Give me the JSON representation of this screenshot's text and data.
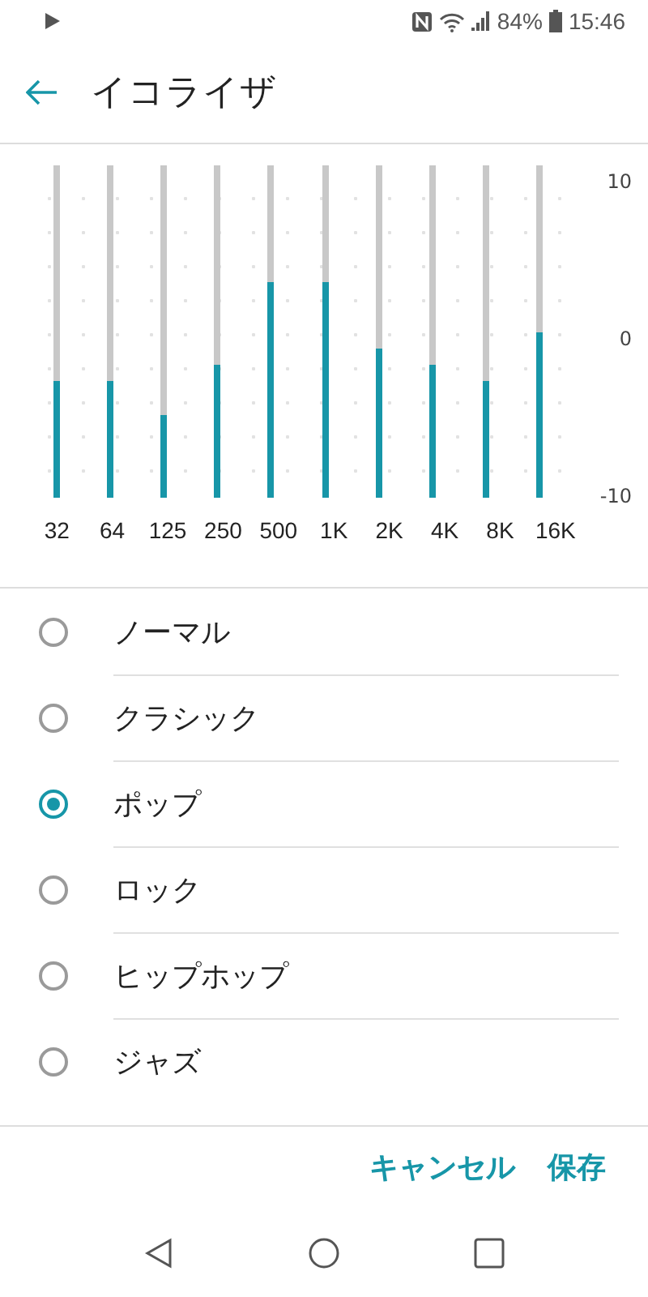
{
  "status_bar": {
    "battery": "84%",
    "time": "15:46"
  },
  "header": {
    "title": "イコライザ"
  },
  "equalizer": {
    "scale": [
      "10",
      "0",
      "-10"
    ],
    "bands": [
      {
        "label": "32",
        "level": 0.35
      },
      {
        "label": "64",
        "level": 0.35
      },
      {
        "label": "125",
        "level": 0.25
      },
      {
        "label": "250",
        "level": 0.4
      },
      {
        "label": "500",
        "level": 0.65
      },
      {
        "label": "1K",
        "level": 0.65
      },
      {
        "label": "2K",
        "level": 0.45
      },
      {
        "label": "4K",
        "level": 0.4
      },
      {
        "label": "8K",
        "level": 0.35
      },
      {
        "label": "16K",
        "level": 0.5
      }
    ]
  },
  "presets": [
    {
      "label": "ノーマル",
      "selected": false
    },
    {
      "label": "クラシック",
      "selected": false
    },
    {
      "label": "ポップ",
      "selected": true
    },
    {
      "label": "ロック",
      "selected": false
    },
    {
      "label": "ヒップホップ",
      "selected": false
    },
    {
      "label": "ジャズ",
      "selected": false
    }
  ],
  "buttons": [
    "キャンセル",
    "保存"
  ]
}
